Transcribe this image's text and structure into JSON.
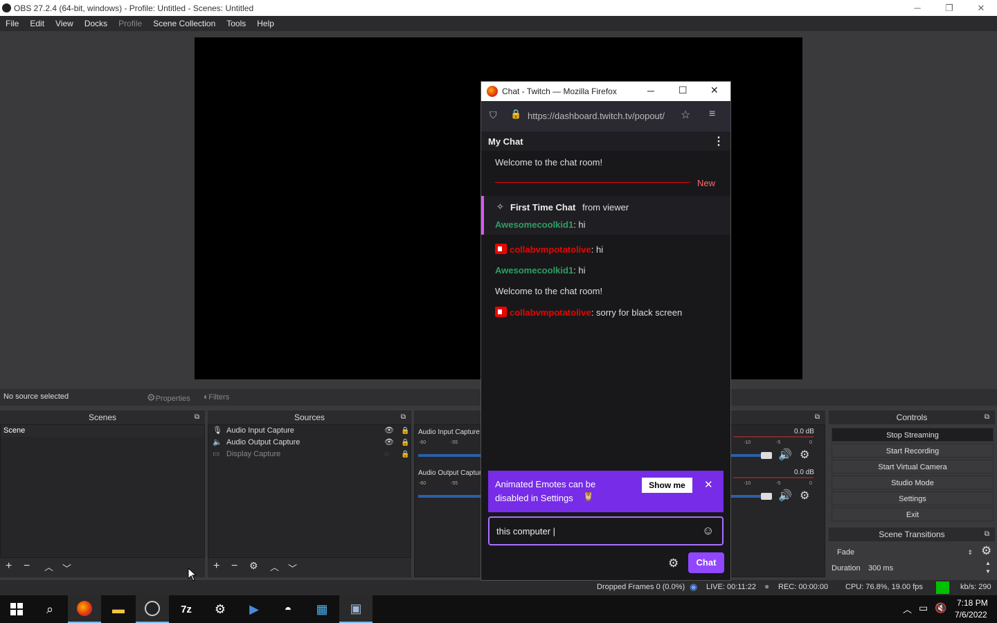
{
  "window": {
    "title": "OBS 27.2.4 (64-bit, windows) - Profile: Untitled - Scenes: Untitled",
    "minimize": "─",
    "restore": "❐",
    "close": "✕"
  },
  "menu": {
    "items": [
      "File",
      "Edit",
      "View",
      "Docks",
      "Profile",
      "Scene Collection",
      "Tools",
      "Help"
    ]
  },
  "context_bar": {
    "status": "No source selected",
    "properties": "Properties",
    "filters": "Filters"
  },
  "scenes": {
    "title": "Scenes",
    "items": [
      "Scene"
    ]
  },
  "sources": {
    "title": "Sources",
    "items": [
      {
        "label": "Audio Input Capture",
        "icon": "microphone-icon",
        "visible": true
      },
      {
        "label": "Audio Output Capture",
        "icon": "speaker-icon",
        "visible": true
      },
      {
        "label": "Display Capture",
        "icon": "monitor-icon",
        "visible": false
      }
    ]
  },
  "mixer": {
    "channels": [
      {
        "name": "Audio Input Capture",
        "db": "0.0 dB"
      },
      {
        "name": "Audio Output Capture",
        "db": "0.0 dB"
      }
    ],
    "scale_left": [
      "-60",
      "-55"
    ],
    "scale_right": [
      "-10",
      "-5",
      "0"
    ]
  },
  "controls": {
    "title": "Controls",
    "buttons": [
      "Stop Streaming",
      "Start Recording",
      "Start Virtual Camera",
      "Studio Mode",
      "Settings",
      "Exit"
    ]
  },
  "transitions": {
    "title": "Scene Transitions",
    "selected": "Fade",
    "duration_label": "Duration",
    "duration_value": "300 ms"
  },
  "status": {
    "dropped": "Dropped Frames 0 (0.0%)",
    "live": "LIVE: 00:11:22",
    "rec": "REC: 00:00:00",
    "cpu": "CPU: 76.8%, 19.00 fps",
    "kbs": "kb/s: 290",
    "health_color": "#00c000"
  },
  "firefox": {
    "title": "Chat - Twitch — Mozilla Firefox",
    "url": "https://dashboard.twitch.tv/popout/",
    "chat_header": "My Chat",
    "messages": {
      "welcome1": "Welcome to the chat room!",
      "new_label": "New",
      "first_time_title": "First Time Chat",
      "first_time_from": "from viewer",
      "m1_user": "Awesomecoolkid1",
      "m1_text": ": hi",
      "m2_user": "collabvmpotatolive",
      "m2_text": ": hi",
      "m3_user": "Awesomecoolkid1",
      "m3_text": ": hi",
      "welcome2": "Welcome to the chat room!",
      "m4_user": "collabvmpotatolive",
      "m4_text": ": sorry for black screen"
    },
    "banner": {
      "line1": "Animated Emotes can be",
      "line2": "disabled in Settings",
      "show_me": "Show me"
    },
    "input_value": "this computer |",
    "chat_button": "Chat"
  },
  "taskbar": {
    "apps": [
      "start-icon",
      "search-icon",
      "firefox-icon",
      "file-explorer-icon",
      "obs-icon",
      "7zip-icon",
      "settings-icon",
      "powershell-icon",
      "app-icon",
      "store-icon",
      "virtualbox-icon"
    ],
    "z7_label": "7z",
    "time": "7:18 PM",
    "date": "7/6/2022"
  }
}
